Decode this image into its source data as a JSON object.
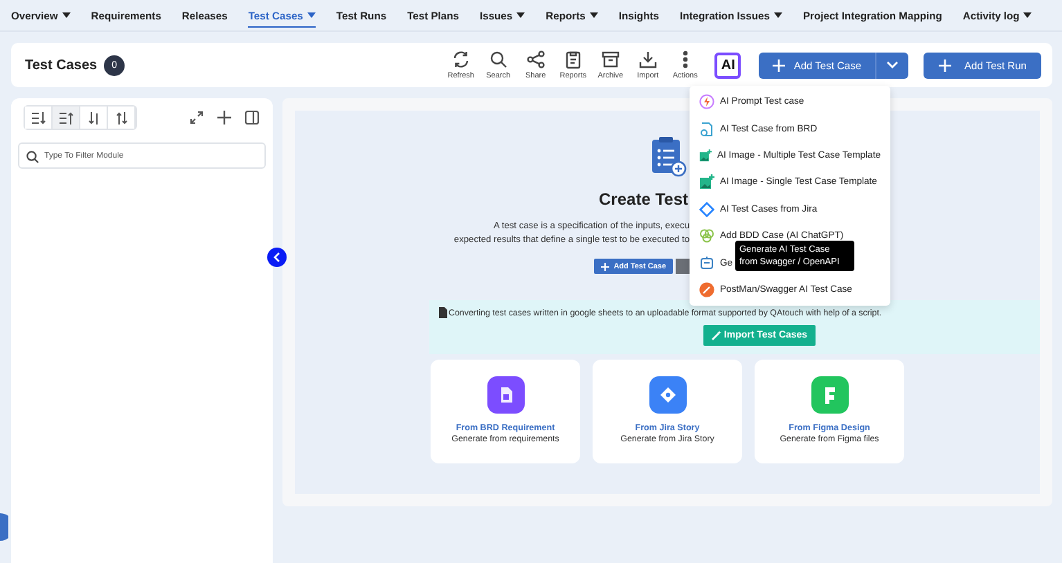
{
  "nav": [
    {
      "label": "Overview",
      "dropdown": true,
      "selected": false
    },
    {
      "label": "Requirements",
      "dropdown": false,
      "selected": false
    },
    {
      "label": "Releases",
      "dropdown": false,
      "selected": false
    },
    {
      "label": "Test Cases",
      "dropdown": true,
      "selected": true
    },
    {
      "label": "Test Runs",
      "dropdown": false,
      "selected": false
    },
    {
      "label": "Test Plans",
      "dropdown": false,
      "selected": false
    },
    {
      "label": "Issues",
      "dropdown": true,
      "selected": false
    },
    {
      "label": "Reports",
      "dropdown": true,
      "selected": false
    },
    {
      "label": "Insights",
      "dropdown": false,
      "selected": false
    },
    {
      "label": "Integration Issues",
      "dropdown": true,
      "selected": false
    },
    {
      "label": "Project Integration Mapping",
      "dropdown": false,
      "selected": false
    },
    {
      "label": "Activity log",
      "dropdown": true,
      "selected": false
    }
  ],
  "header": {
    "title": "Test Cases",
    "count": "0",
    "tools": [
      {
        "kind": "refresh",
        "label": "Refresh"
      },
      {
        "kind": "search",
        "label": "Search"
      },
      {
        "kind": "share",
        "label": "Share"
      },
      {
        "kind": "reports",
        "label": "Reports"
      },
      {
        "kind": "archive",
        "label": "Archive"
      },
      {
        "kind": "import",
        "label": "Import"
      },
      {
        "kind": "actions",
        "label": "Actions"
      }
    ],
    "ai_label": "AI",
    "add_test_case": "Add Test Case",
    "add_test_run": "Add Test Run"
  },
  "left_panel": {
    "sort_buttons": [
      {
        "kind": "lines-down",
        "selected": false
      },
      {
        "kind": "lines-up",
        "selected": true
      },
      {
        "kind": "sort-down",
        "selected": false
      },
      {
        "kind": "sort-up",
        "selected": false
      }
    ],
    "filter_placeholder": "Type To Filter Module"
  },
  "main": {
    "title": "Create Test",
    "description": [
      "A test case is a specification of the inputs, execu",
      "expected results that define a single test to be executed to"
    ],
    "add_button": "Add Test Case",
    "converting_text": "Converting test cases written in google sheets to an uploadable format supported by QAtouch with help of a script.",
    "import_button": "Import Test Cases",
    "cards": [
      {
        "kind": "document",
        "title": "From BRD Requirement",
        "subtitle": "Generate from requirements"
      },
      {
        "kind": "jira",
        "title": "From Jira Story",
        "subtitle": "Generate from Jira Story"
      },
      {
        "kind": "figma",
        "title": "From Figma Design",
        "subtitle": "Generate from Figma files"
      }
    ]
  },
  "menu": {
    "items": [
      {
        "kind": "prompt",
        "label": "AI Prompt Test case"
      },
      {
        "kind": "brd",
        "label": "AI Test Case from BRD"
      },
      {
        "kind": "image",
        "label": "AI Image - Multiple Test Case Template"
      },
      {
        "kind": "image",
        "label": "AI Image - Single Test Case Template"
      },
      {
        "kind": "jira",
        "label": "AI Test Cases from Jira"
      },
      {
        "kind": "bdd",
        "label": "Add BDD Case (AI ChatGPT)"
      },
      {
        "kind": "swagger",
        "label": "Ge"
      },
      {
        "kind": "postman",
        "label": "PostMan/Swagger AI Test Case"
      }
    ],
    "tooltip": "Generate AI Test Case from Swagger / OpenAPI"
  }
}
